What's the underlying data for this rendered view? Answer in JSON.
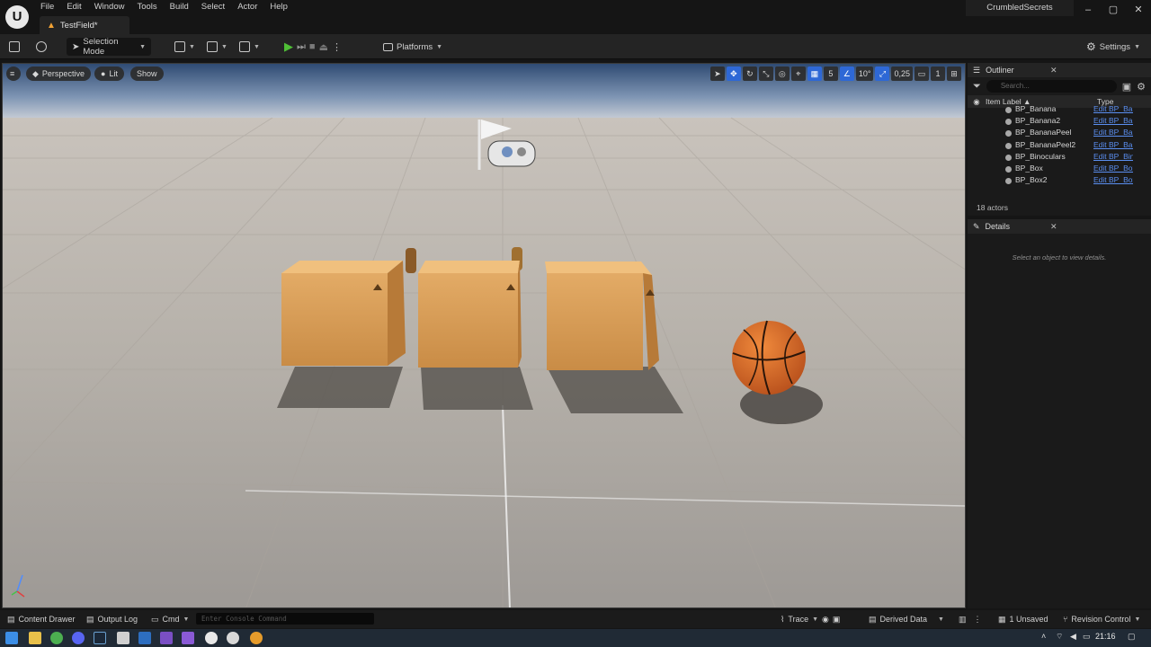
{
  "app": {
    "logo_text": "U",
    "menu": [
      "File",
      "Edit",
      "Window",
      "Tools",
      "Build",
      "Select",
      "Actor",
      "Help"
    ],
    "level_tab": "TestField*",
    "project": "CrumbledSecrets",
    "window_controls": [
      "–",
      "▢",
      "✕"
    ]
  },
  "toolbar": {
    "mode_label": "Selection Mode",
    "platforms_label": "Platforms",
    "settings_label": "Settings"
  },
  "viewport": {
    "menu_icon": "≡",
    "perspective_label": "Perspective",
    "lit_label": "Lit",
    "show_label": "Show",
    "grid_snap": "5",
    "rotation_snap": "10°",
    "scale_snap": "0,25",
    "camera_speed": "1"
  },
  "outliner": {
    "tab_label": "Outliner",
    "search_placeholder": "Search...",
    "col_item_label": "Item Label ▲",
    "col_type": "Type",
    "rows": [
      {
        "name": "BP_Banana",
        "type": "Edit BP_Ban"
      },
      {
        "name": "BP_Banana2",
        "type": "Edit BP_Bar"
      },
      {
        "name": "BP_BananaPeel",
        "type": "Edit BP_Bar"
      },
      {
        "name": "BP_BananaPeel2",
        "type": "Edit BP_Bar"
      },
      {
        "name": "BP_Binoculars",
        "type": "Edit BP_Bin"
      },
      {
        "name": "BP_Box",
        "type": "Edit BP_Box"
      },
      {
        "name": "BP_Box2",
        "type": "Edit BP_Box"
      }
    ],
    "actor_count": "18 actors"
  },
  "details": {
    "tab_label": "Details",
    "empty_text": "Select an object to view details."
  },
  "statusbar": {
    "content_drawer": "Content Drawer",
    "output_log": "Output Log",
    "cmd": "Cmd",
    "console_placeholder": "Enter Console Command",
    "trace": "Trace",
    "derived_data": "Derived Data",
    "unsaved": "1 Unsaved",
    "revision_control": "Revision Control"
  },
  "taskbar": {
    "clock": "21:16"
  },
  "colors": {
    "accent_blue": "#2e68d6",
    "play_green": "#4fbf36",
    "warning_orange": "#f2a234",
    "link_blue": "#5a8ef0"
  }
}
